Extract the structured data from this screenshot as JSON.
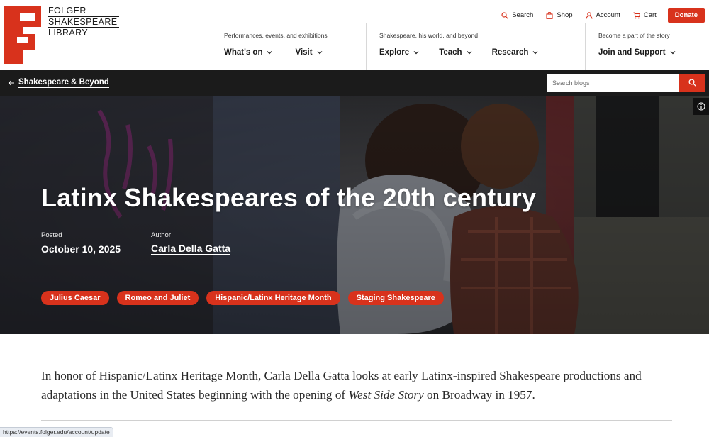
{
  "brand": {
    "line1": "FOLGER",
    "line2": "SHAKESPEARE",
    "line3": "LIBRARY",
    "color": "#d8321c"
  },
  "utility": {
    "search": "Search",
    "shop": "Shop",
    "account": "Account",
    "cart": "Cart",
    "donate": "Donate"
  },
  "nav": {
    "groups": [
      {
        "caption": "Performances, events, and exhibitions",
        "items": [
          "What's on",
          "Visit"
        ]
      },
      {
        "caption": "Shakespeare, his world, and beyond",
        "items": [
          "Explore",
          "Teach",
          "Research"
        ]
      },
      {
        "caption": "Become a part of the story",
        "items": [
          "Join and Support"
        ]
      }
    ]
  },
  "blog_bar": {
    "back_label": "Shakespeare & Beyond",
    "search_placeholder": "Search blogs"
  },
  "hero": {
    "title": "Latinx Shakespeares of the 20th century",
    "posted_label": "Posted",
    "posted_value": "October 10, 2025",
    "author_label": "Author",
    "author_value": "Carla Della Gatta",
    "tags": [
      "Julius Caesar",
      "Romeo and Juliet",
      "Hispanic/Latinx Heritage Month",
      "Staging Shakespeare"
    ]
  },
  "article": {
    "lede_before": "In honor of Hispanic/Latinx Heritage Month, Carla Della Gatta looks at early Latinx-inspired Shakespeare productions and adaptations in the United States beginning with the opening of ",
    "lede_italic": "West Side Story",
    "lede_after": " on Broadway in 1957."
  },
  "status_bar": {
    "url": "https://events.folger.edu/account/update"
  },
  "colors": {
    "accent": "#d8321c",
    "bar_dark": "#1b1b1b"
  }
}
